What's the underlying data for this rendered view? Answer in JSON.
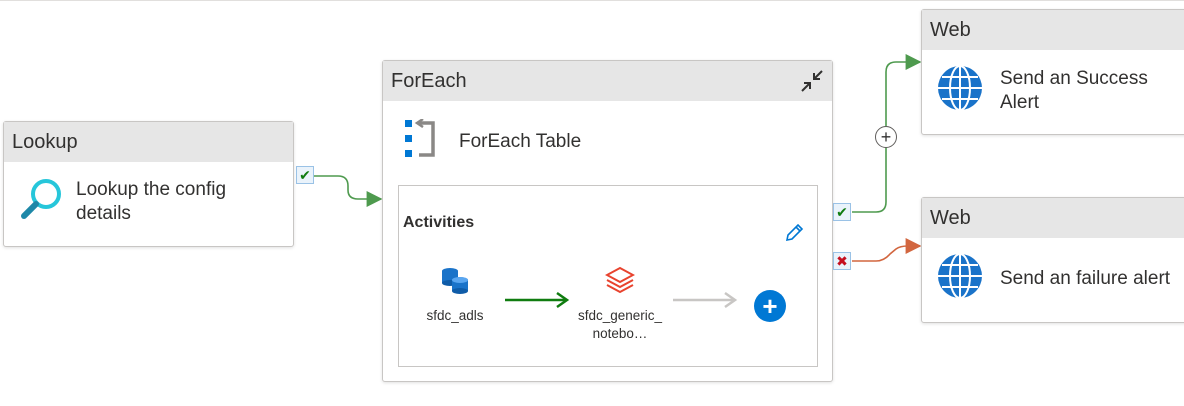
{
  "lookup": {
    "header": "Lookup",
    "title": "Lookup the config details",
    "icon": "search-icon"
  },
  "foreach": {
    "header": "ForEach",
    "title": "ForEach Table",
    "activities_label": "Activities",
    "nodes": [
      {
        "label": "sfdc_adls",
        "icon": "database-icon"
      },
      {
        "label": "sfdc_generic_notebo…",
        "icon": "databricks-icon"
      }
    ]
  },
  "web_success": {
    "header": "Web",
    "title": "Send an Success Alert",
    "icon": "globe-icon"
  },
  "web_failure": {
    "header": "Web",
    "title": "Send an failure alert",
    "icon": "globe-icon"
  },
  "colors": {
    "success": "#4e9a4e",
    "failure": "#d2663f",
    "accent": "#0078d4",
    "header_bg": "#e6e6e6"
  }
}
